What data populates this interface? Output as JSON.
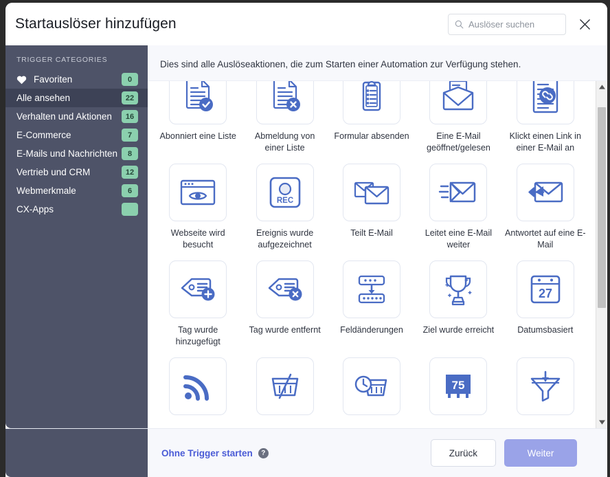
{
  "dialog": {
    "title": "Startauslöser hinzufügen",
    "close_label": "close-icon"
  },
  "search": {
    "placeholder": "Auslöser suchen",
    "value": ""
  },
  "sidebar": {
    "heading": "TRIGGER CATEGORIES",
    "items": [
      {
        "label": "Favoriten",
        "badge": "0",
        "icon": "heart-icon",
        "selected": false
      },
      {
        "label": "Alle ansehen",
        "badge": "22",
        "icon": "",
        "selected": true
      },
      {
        "label": "Verhalten und Aktionen",
        "badge": "16",
        "icon": "",
        "selected": false
      },
      {
        "label": "E-Commerce",
        "badge": "7",
        "icon": "",
        "selected": false
      },
      {
        "label": "E-Mails und Nachrichten",
        "badge": "8",
        "icon": "",
        "selected": false
      },
      {
        "label": "Vertrieb und CRM",
        "badge": "12",
        "icon": "",
        "selected": false
      },
      {
        "label": "Webmerkmale",
        "badge": "6",
        "icon": "",
        "selected": false
      },
      {
        "label": "CX-Apps",
        "badge": "",
        "icon": "",
        "selected": false
      }
    ]
  },
  "main": {
    "subtitle": "Dies sind alle Auslöseaktionen, die zum Starten einer Automation zur Verfügung stehen.",
    "triggers": [
      {
        "label": "Abonniert eine Liste",
        "icon": "document-check-icon"
      },
      {
        "label": "Abmeldung von einer Liste",
        "icon": "document-x-icon"
      },
      {
        "label": "Formular absenden",
        "icon": "clipboard-list-icon"
      },
      {
        "label": "Eine E-Mail geöffnet/gelesen",
        "icon": "envelope-open-icon"
      },
      {
        "label": "Klickt einen Link in einer E-Mail an",
        "icon": "document-link-icon"
      },
      {
        "label": "Webseite wird besucht",
        "icon": "browser-eye-icon"
      },
      {
        "label": "Ereignis wurde aufgezeichnet",
        "icon": "record-button-icon"
      },
      {
        "label": "Teilt E-Mail",
        "icon": "share-envelope-icon"
      },
      {
        "label": "Leitet eine E-Mail weiter",
        "icon": "forward-envelope-icon"
      },
      {
        "label": "Antwortet auf eine E-Mail",
        "icon": "reply-envelope-icon"
      },
      {
        "label": "Tag wurde hinzugefügt",
        "icon": "tag-plus-icon"
      },
      {
        "label": "Tag wurde entfernt",
        "icon": "tag-x-icon"
      },
      {
        "label": "Feldänderungen",
        "icon": "field-change-icon"
      },
      {
        "label": "Ziel wurde erreicht",
        "icon": "trophy-icon"
      },
      {
        "label": "Datumsbasiert",
        "icon": "calendar-27-icon"
      },
      {
        "label": "",
        "icon": "rss-icon"
      },
      {
        "label": "",
        "icon": "abandoned-cart-icon"
      },
      {
        "label": "",
        "icon": "cart-clock-icon"
      },
      {
        "label": "",
        "icon": "score-75-icon"
      },
      {
        "label": "",
        "icon": "funnel-icon"
      }
    ],
    "calendar_day": "27",
    "score_value": "75",
    "record_label": "REC"
  },
  "footer": {
    "no_trigger_label": "Ohne Trigger starten",
    "help_glyph": "?",
    "back_label": "Zurück",
    "next_label": "Weiter"
  },
  "colors": {
    "sidebar_bg": "#4e5368",
    "sidebar_selected": "#3d4256",
    "badge_green": "#8bd0ae",
    "icon_blue": "#4a6cc4",
    "primary_button": "#9aa3e8",
    "link_blue": "#4a5bd6"
  }
}
